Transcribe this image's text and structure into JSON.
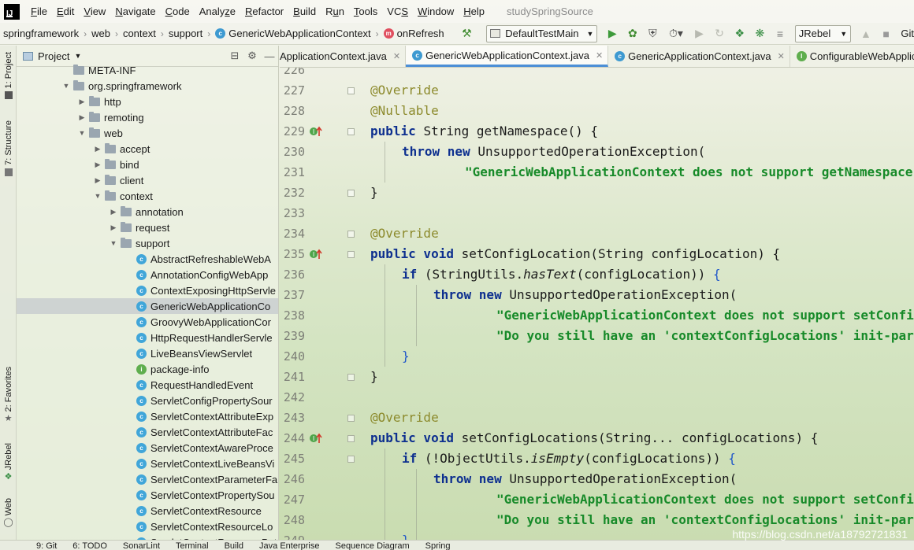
{
  "menubar": {
    "items": [
      "File",
      "Edit",
      "View",
      "Navigate",
      "Code",
      "Analyze",
      "Refactor",
      "Build",
      "Run",
      "Tools",
      "VCS",
      "Window",
      "Help"
    ],
    "mnemonics": [
      "F",
      "E",
      "V",
      "N",
      "C",
      "z",
      "R",
      "B",
      "u",
      "T",
      "S",
      "W",
      "H"
    ],
    "project_name": "studySpringSource"
  },
  "navbar": {
    "breadcrumbs": [
      "springframework",
      "web",
      "context",
      "support",
      "GenericWebApplicationContext",
      "onRefresh"
    ],
    "run_config": "DefaultTestMain",
    "jrebel": "JRebel",
    "git_label": "Git"
  },
  "left_stripe": {
    "tabs": [
      "1: Project",
      "7: Structure",
      "2: Favorites",
      "JRebel",
      "Web"
    ]
  },
  "project_panel": {
    "title": "Project",
    "tree": [
      {
        "label": "META-INF",
        "depth": 3,
        "kind": "folder",
        "arrow": ""
      },
      {
        "label": "org.springframework",
        "depth": 3,
        "kind": "folder",
        "arrow": "open"
      },
      {
        "label": "http",
        "depth": 4,
        "kind": "folder",
        "arrow": "closed"
      },
      {
        "label": "remoting",
        "depth": 4,
        "kind": "folder",
        "arrow": "closed"
      },
      {
        "label": "web",
        "depth": 4,
        "kind": "folder",
        "arrow": "open"
      },
      {
        "label": "accept",
        "depth": 5,
        "kind": "folder",
        "arrow": "closed"
      },
      {
        "label": "bind",
        "depth": 5,
        "kind": "folder",
        "arrow": "closed"
      },
      {
        "label": "client",
        "depth": 5,
        "kind": "folder",
        "arrow": "closed"
      },
      {
        "label": "context",
        "depth": 5,
        "kind": "folder",
        "arrow": "open"
      },
      {
        "label": "annotation",
        "depth": 6,
        "kind": "folder",
        "arrow": "closed"
      },
      {
        "label": "request",
        "depth": 6,
        "kind": "folder",
        "arrow": "closed"
      },
      {
        "label": "support",
        "depth": 6,
        "kind": "folder",
        "arrow": "open"
      },
      {
        "label": "AbstractRefreshableWebA",
        "depth": 7,
        "kind": "class",
        "arrow": ""
      },
      {
        "label": "AnnotationConfigWebApp",
        "depth": 7,
        "kind": "class",
        "arrow": ""
      },
      {
        "label": "ContextExposingHttpServle",
        "depth": 7,
        "kind": "class",
        "arrow": ""
      },
      {
        "label": "GenericWebApplicationCo",
        "depth": 7,
        "kind": "class",
        "arrow": "",
        "selected": true
      },
      {
        "label": "GroovyWebApplicationCor",
        "depth": 7,
        "kind": "class",
        "arrow": ""
      },
      {
        "label": "HttpRequestHandlerServle",
        "depth": 7,
        "kind": "class",
        "arrow": ""
      },
      {
        "label": "LiveBeansViewServlet",
        "depth": 7,
        "kind": "class",
        "arrow": ""
      },
      {
        "label": "package-info",
        "depth": 7,
        "kind": "info",
        "arrow": ""
      },
      {
        "label": "RequestHandledEvent",
        "depth": 7,
        "kind": "class",
        "arrow": ""
      },
      {
        "label": "ServletConfigPropertySour",
        "depth": 7,
        "kind": "class",
        "arrow": ""
      },
      {
        "label": "ServletContextAttributeExp",
        "depth": 7,
        "kind": "class",
        "arrow": ""
      },
      {
        "label": "ServletContextAttributeFac",
        "depth": 7,
        "kind": "class",
        "arrow": ""
      },
      {
        "label": "ServletContextAwareProce",
        "depth": 7,
        "kind": "class",
        "arrow": ""
      },
      {
        "label": "ServletContextLiveBeansVi",
        "depth": 7,
        "kind": "class",
        "arrow": ""
      },
      {
        "label": "ServletContextParameterFa",
        "depth": 7,
        "kind": "class",
        "arrow": ""
      },
      {
        "label": "ServletContextPropertySou",
        "depth": 7,
        "kind": "class",
        "arrow": ""
      },
      {
        "label": "ServletContextResource",
        "depth": 7,
        "kind": "class",
        "arrow": ""
      },
      {
        "label": "ServletContextResourceLo",
        "depth": 7,
        "kind": "class",
        "arrow": ""
      },
      {
        "label": "ServletContextResourcePat",
        "depth": 7,
        "kind": "class",
        "arrow": ""
      }
    ]
  },
  "tabs": [
    {
      "label": "ApplicationContext.java",
      "icon": "",
      "active": false
    },
    {
      "label": "GenericWebApplicationContext.java",
      "icon": "C",
      "active": true
    },
    {
      "label": "GenericApplicationContext.java",
      "icon": "C",
      "active": false
    },
    {
      "label": "ConfigurableWebApplica",
      "icon": "I",
      "active": false
    }
  ],
  "editor": {
    "lines": [
      {
        "n": "226",
        "tokens": [],
        "marker": ""
      },
      {
        "n": "227",
        "tokens": [
          [
            "ann",
            "@Override"
          ]
        ],
        "indent": 0,
        "marker": ""
      },
      {
        "n": "228",
        "tokens": [
          [
            "ann",
            "@Nullable"
          ]
        ],
        "indent": 0,
        "marker": ""
      },
      {
        "n": "229",
        "tokens": [
          [
            "kw",
            "public "
          ],
          [
            "",
            "String getNamespace() {"
          ]
        ],
        "indent": 0,
        "marker": "override"
      },
      {
        "n": "230",
        "tokens": [
          [
            "kw",
            "throw new "
          ],
          [
            "",
            "UnsupportedOperationException("
          ]
        ],
        "indent": 1,
        "marker": ""
      },
      {
        "n": "231",
        "tokens": [
          [
            "str",
            "\"GenericWebApplicationContext does not support getNamespace\");"
          ]
        ],
        "indent": 3,
        "marker": ""
      },
      {
        "n": "232",
        "tokens": [
          [
            "",
            "}"
          ]
        ],
        "indent": 0,
        "marker": ""
      },
      {
        "n": "233",
        "tokens": [],
        "marker": ""
      },
      {
        "n": "234",
        "tokens": [
          [
            "ann",
            "@Override"
          ]
        ],
        "indent": 0,
        "marker": ""
      },
      {
        "n": "235",
        "tokens": [
          [
            "kw",
            "public void "
          ],
          [
            "",
            "setConfigLocation(String configLocation) {"
          ]
        ],
        "indent": 0,
        "marker": "override"
      },
      {
        "n": "236",
        "tokens": [
          [
            "kw",
            "if "
          ],
          [
            "",
            "(StringUtils."
          ],
          [
            "ital",
            "hasText"
          ],
          [
            "",
            "(configLocation)) "
          ],
          [
            "blue",
            "{"
          ]
        ],
        "indent": 1,
        "marker": ""
      },
      {
        "n": "237",
        "tokens": [
          [
            "kw",
            "throw new "
          ],
          [
            "",
            "UnsupportedOperationException("
          ]
        ],
        "indent": 2,
        "marker": ""
      },
      {
        "n": "238",
        "tokens": [
          [
            "str",
            "\"GenericWebApplicationContext does not support setConfigLocation\" +"
          ]
        ],
        "indent": 4,
        "marker": ""
      },
      {
        "n": "239",
        "tokens": [
          [
            "str",
            "\"Do you still have an 'contextConfigLocations' init-param set?\");"
          ]
        ],
        "indent": 4,
        "marker": ""
      },
      {
        "n": "240",
        "tokens": [
          [
            "blue",
            "}"
          ]
        ],
        "indent": 1,
        "marker": ""
      },
      {
        "n": "241",
        "tokens": [
          [
            "",
            "}"
          ]
        ],
        "indent": 0,
        "marker": ""
      },
      {
        "n": "242",
        "tokens": [],
        "marker": ""
      },
      {
        "n": "243",
        "tokens": [
          [
            "ann",
            "@Override"
          ]
        ],
        "indent": 0,
        "marker": ""
      },
      {
        "n": "244",
        "tokens": [
          [
            "kw",
            "public void "
          ],
          [
            "",
            "setConfigLocations(String... configLocations) {"
          ]
        ],
        "indent": 0,
        "marker": "override"
      },
      {
        "n": "245",
        "tokens": [
          [
            "kw",
            "if "
          ],
          [
            "",
            "(!ObjectUtils."
          ],
          [
            "ital",
            "isEmpty"
          ],
          [
            "",
            "(configLocations)) "
          ],
          [
            "blue",
            "{"
          ]
        ],
        "indent": 1,
        "marker": ""
      },
      {
        "n": "246",
        "tokens": [
          [
            "kw",
            "throw new "
          ],
          [
            "",
            "UnsupportedOperationException("
          ]
        ],
        "indent": 2,
        "marker": ""
      },
      {
        "n": "247",
        "tokens": [
          [
            "str",
            "\"GenericWebApplicationContext does not support setConfigLocations\" +"
          ]
        ],
        "indent": 4,
        "marker": ""
      },
      {
        "n": "248",
        "tokens": [
          [
            "str",
            "\"Do you still have an 'contextConfigLocations' init-param set?\");"
          ]
        ],
        "indent": 4,
        "marker": ""
      },
      {
        "n": "249",
        "tokens": [
          [
            "blue",
            "}"
          ]
        ],
        "indent": 1,
        "marker": ""
      }
    ]
  },
  "bottom_strip": {
    "items": [
      "9: Git",
      "6: TODO",
      "SonarLint",
      "Terminal",
      "Build",
      "Java Enterprise",
      "Sequence Diagram",
      "Spring"
    ]
  },
  "watermark": "https://blog.csdn.net/a18792721831"
}
